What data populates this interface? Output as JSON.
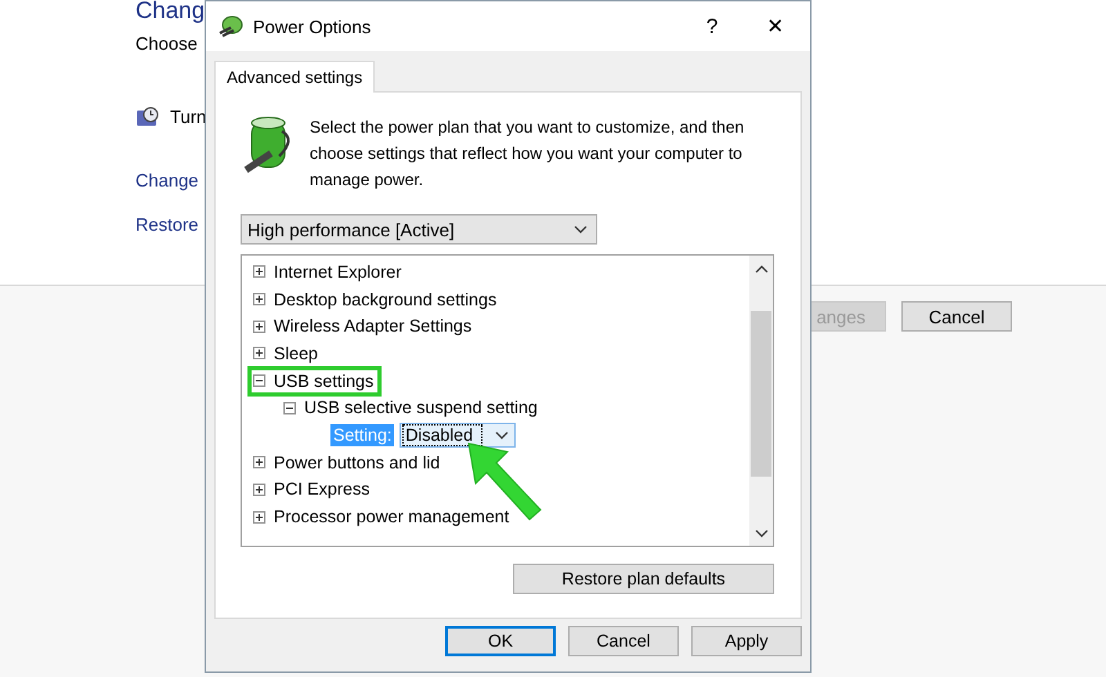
{
  "background_window": {
    "title": "Chang",
    "subtitle": "Choose",
    "items": [
      {
        "kind": "icon-link",
        "label": "Turn"
      },
      {
        "kind": "link",
        "label": "Change"
      },
      {
        "kind": "link",
        "label": "Restore"
      }
    ],
    "buttons": [
      {
        "label": "anges",
        "disabled": true
      },
      {
        "label": "Cancel",
        "disabled": false
      }
    ]
  },
  "dialog": {
    "title": "Power Options",
    "help": "?",
    "close": "✕",
    "tabs": [
      {
        "label": "Advanced settings",
        "selected": true
      }
    ],
    "description": "Select the power plan that you want to customize, and then choose settings that reflect how you want your computer to manage power.",
    "plan": {
      "value": "High performance [Active]"
    },
    "tree": [
      {
        "kind": "group",
        "label": "Internet Explorer",
        "expanded": false,
        "highlighted": false
      },
      {
        "kind": "group",
        "label": "Desktop background settings",
        "expanded": false,
        "highlighted": false
      },
      {
        "kind": "group",
        "label": "Wireless Adapter Settings",
        "expanded": false,
        "highlighted": false
      },
      {
        "kind": "group",
        "label": "Sleep",
        "expanded": false,
        "highlighted": false
      },
      {
        "kind": "group",
        "label": "USB settings",
        "expanded": true,
        "highlighted": true,
        "children": [
          {
            "kind": "group",
            "label": "USB selective suspend setting",
            "expanded": true,
            "highlighted": false,
            "children": [
              {
                "kind": "setting",
                "label": "Setting:",
                "selected": true,
                "value": "Disabled"
              }
            ]
          }
        ]
      },
      {
        "kind": "group",
        "label": "Power buttons and lid",
        "expanded": false,
        "highlighted": false
      },
      {
        "kind": "group",
        "label": "PCI Express",
        "expanded": false,
        "highlighted": false
      },
      {
        "kind": "group",
        "label": "Processor power management",
        "expanded": false,
        "highlighted": false
      }
    ],
    "restore_button": "Restore plan defaults",
    "buttons": [
      {
        "label": "OK",
        "default": true
      },
      {
        "label": "Cancel",
        "default": false
      },
      {
        "label": "Apply",
        "default": false
      }
    ]
  }
}
